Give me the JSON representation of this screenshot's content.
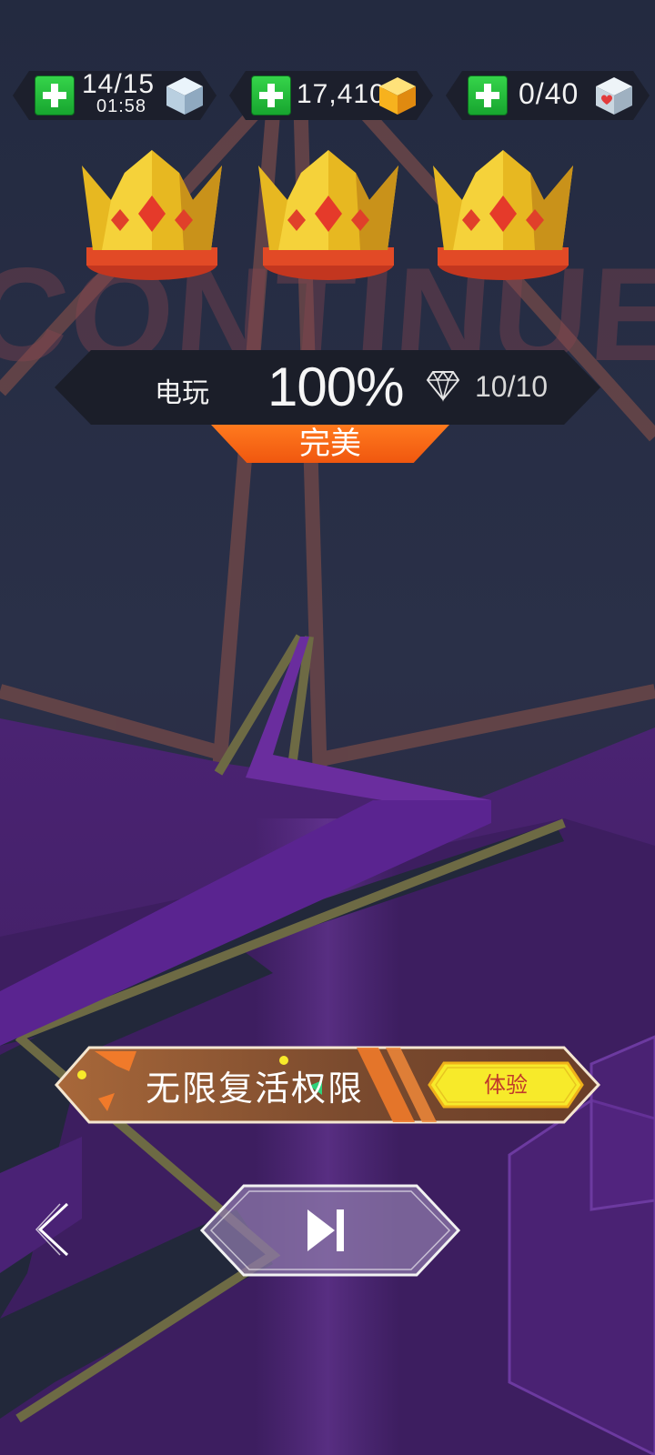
{
  "hud": {
    "energy": {
      "value": "14/15",
      "timer": "01:58",
      "icon": "energy-cube-icon"
    },
    "coins": {
      "value": "17,410",
      "icon": "gold-cube-icon"
    },
    "hearts": {
      "value": "0/40",
      "icon": "heart-cube-icon"
    }
  },
  "background_text": "CONTINUE ?",
  "crowns": {
    "count": 3,
    "earned": 3,
    "icon": "crown-icon"
  },
  "result": {
    "level_name": "电玩",
    "progress": "100%",
    "gem_count": "10/10",
    "gem_icon": "diamond-icon",
    "rating": "完美"
  },
  "promo": {
    "title": "无限复活权限",
    "button_label": "体验"
  },
  "nav": {
    "back_icon": "chevron-left-icon",
    "next_icon": "skip-next-icon"
  },
  "colors": {
    "track_purple": "#5a2a8a",
    "accent_orange": "#f0641a",
    "plus_green": "#22b93a",
    "button_yellow": "#f7ea2a"
  }
}
